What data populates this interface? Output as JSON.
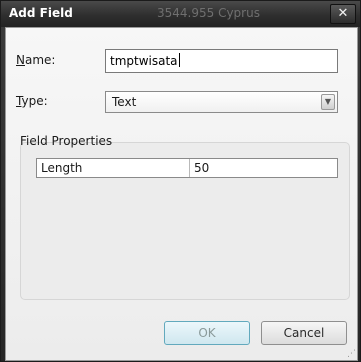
{
  "window": {
    "title": "Add Field",
    "background_title_text": "3544.955 Cyprus",
    "close_glyph": "✕"
  },
  "form": {
    "name_label_accesskey": "N",
    "name_label_rest": "ame:",
    "name_value": "tmptwisata",
    "type_label_accesskey": "T",
    "type_label_rest": "ype:",
    "type_value": "Text",
    "dropdown_glyph": "▼"
  },
  "field_properties": {
    "title": "Field Properties",
    "rows": [
      {
        "key": "Length",
        "value": "50"
      }
    ]
  },
  "buttons": {
    "ok_label": "OK",
    "cancel_label": "Cancel"
  },
  "colors": {
    "titlebar": "#2e2e2e",
    "ok_border": "#62a9bd"
  }
}
